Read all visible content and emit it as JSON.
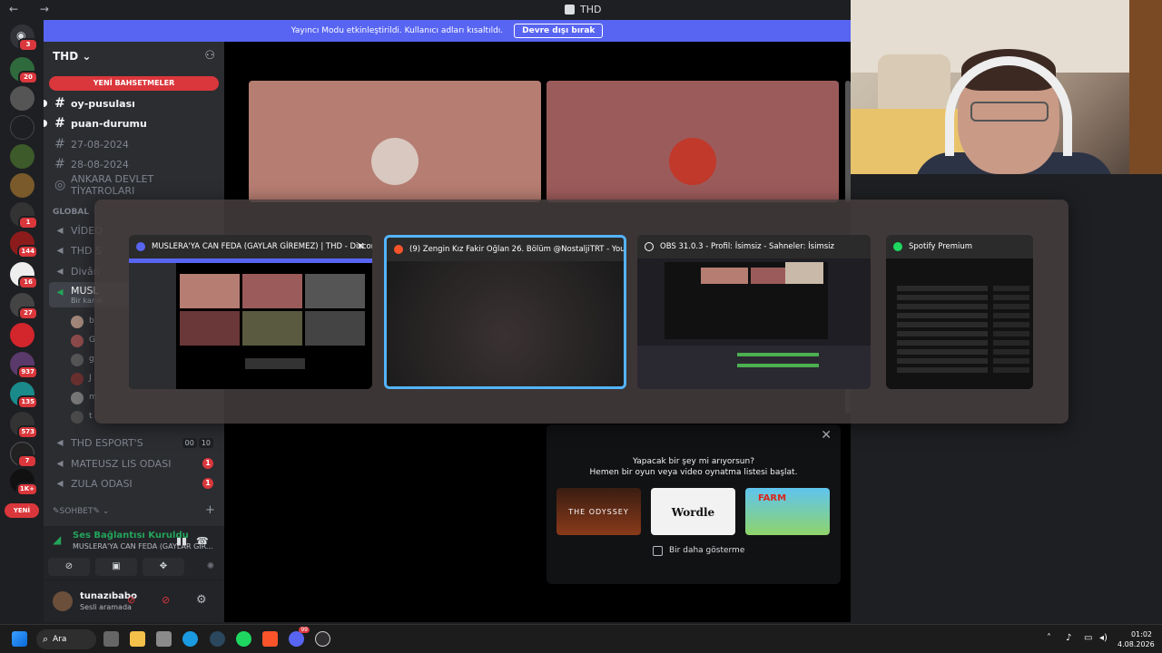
{
  "window": {
    "title": "THD",
    "nav": "← →"
  },
  "banner": {
    "text": "Yayıncı Modu etkinleştirildi. Kullanıcı adları kısaltıldı.",
    "button": "Devre dışı bırak"
  },
  "rail": {
    "badges": [
      "3",
      "20",
      "1",
      "144",
      "16",
      "27",
      "937",
      "135",
      "573",
      "7",
      "1K+"
    ],
    "new_label": "YENİ"
  },
  "guild": {
    "name": "THD ⌄",
    "add_icon": "add-user-icon"
  },
  "mentions_pill": "YENİ BAHSETMELER",
  "channels": {
    "text": [
      {
        "name": "oy-pusulası",
        "unread": true
      },
      {
        "name": "puan-durumu",
        "unread": true
      },
      {
        "name": "27-08-2024",
        "unread": false
      },
      {
        "name": "28-08-2024",
        "unread": false
      },
      {
        "name": "ANKARA DEVLET TİYATROLARI",
        "unread": false
      }
    ],
    "global_category": "GLOBAL",
    "partial": [
      "VİDEO",
      "THD S",
      "Divân",
      "MUSL"
    ],
    "partial_sub": "Bir kanal",
    "voice": [
      {
        "name": "THD ESPORT'S",
        "counts": [
          "00",
          "10"
        ]
      },
      {
        "name": "MATEUSZ LIS ODASI",
        "badge": "1"
      },
      {
        "name": "ZULA ODASI",
        "badge": "1"
      }
    ],
    "chat_category": "✎SOHBET✎ ⌄",
    "member_initials": [
      "b",
      "G",
      "g",
      "J",
      "m",
      "t"
    ]
  },
  "voice_panel": {
    "status": "Ses Bağlantısı Kuruldu",
    "channel": "MUSLERA'YA CAN FEDA (GAYLAR GİR..."
  },
  "user_panel": {
    "name": "tunazıbabo",
    "status": "Sesli aramada"
  },
  "switcher": [
    {
      "title": "MUSLERA'YA CAN FEDA (GAYLAR GİREMEZ) | THD - Discord",
      "app": "discord-icon",
      "color": "#5865f2"
    },
    {
      "title": "(9) Zengin Kız Fakir Oğlan 26. Bölüm @NostaljiTRT - YouTube...",
      "app": "brave-icon",
      "color": "#fb542b"
    },
    {
      "title": "OBS 31.0.3 - Profil: İsimsiz - Sahneler: İsimsiz",
      "app": "obs-icon",
      "color": "#302e31"
    },
    {
      "title": "Spotify Premium",
      "app": "spotify-icon",
      "color": "#1ed760"
    }
  ],
  "suggest": {
    "line1": "Yapacak bir şey mi arıyorsun?",
    "line2": "Hemen bir oyun veya video oynatma listesi başlat.",
    "games": [
      "THE ODYSSEY",
      "Wordle",
      "FARM"
    ],
    "checkbox": "Bir daha gösterme"
  },
  "taskbar": {
    "search": "Ara",
    "discord_badge": "99",
    "time": "01:02",
    "date": "4.08.2026"
  }
}
